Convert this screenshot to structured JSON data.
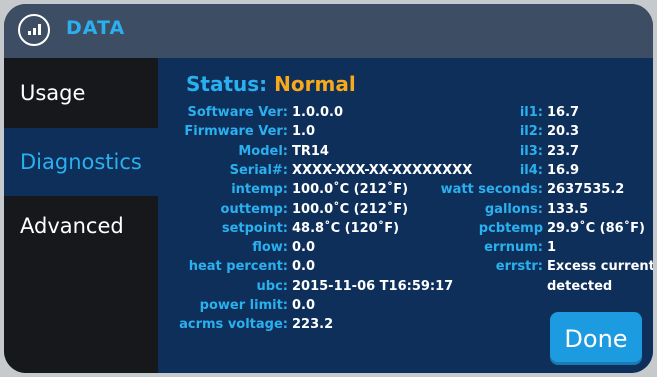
{
  "window": {
    "title": "DATA",
    "icon": "data-chart-icon"
  },
  "sidebar": {
    "items": [
      {
        "label": "Usage"
      },
      {
        "label": "Diagnostics",
        "active": true
      },
      {
        "label": "Advanced"
      }
    ]
  },
  "status": {
    "label": "Status:",
    "value": "Normal"
  },
  "left_fields": [
    {
      "key": "Software Ver:",
      "value": "1.0.0.0"
    },
    {
      "key": "Firmware Ver:",
      "value": "1.0"
    },
    {
      "key": "Model:",
      "value": "TR14"
    },
    {
      "key": "Serial#:",
      "value": "XXXX-XXX-XX-XXXXXXXX"
    },
    {
      "key": "intemp:",
      "value": "100.0˚C (212˚F)"
    },
    {
      "key": "outtemp:",
      "value": "100.0˚C (212˚F)"
    },
    {
      "key": "setpoint:",
      "value": "48.8˚C (120˚F)"
    },
    {
      "key": "flow:",
      "value": "0.0"
    },
    {
      "key": "heat percent:",
      "value": "0.0"
    },
    {
      "key": "ubc:",
      "value": "2015-11-06 T16:59:17"
    },
    {
      "key": "power limit:",
      "value": "0.0"
    },
    {
      "key": "acrms voltage:",
      "value": "223.2"
    }
  ],
  "right_fields": [
    {
      "key": "il1:",
      "value": "16.7"
    },
    {
      "key": "il2:",
      "value": "20.3"
    },
    {
      "key": "il3:",
      "value": "23.7"
    },
    {
      "key": "il4:",
      "value": "16.9"
    },
    {
      "key": "watt seconds:",
      "value": "2637535.2"
    },
    {
      "key": "gallons:",
      "value": "133.5"
    },
    {
      "key": "pcbtemp",
      "value": "29.9˚C (86˚F)"
    },
    {
      "key": "errnum:",
      "value": "1"
    },
    {
      "key": "errstr:",
      "value": "Excess current",
      "value2": "detected"
    }
  ],
  "done_label": "Done",
  "colors": {
    "accent": "#2bb0ef",
    "status": "#f7a81b",
    "panel": "#0e2f5a",
    "titlebar": "#3d4e64"
  }
}
